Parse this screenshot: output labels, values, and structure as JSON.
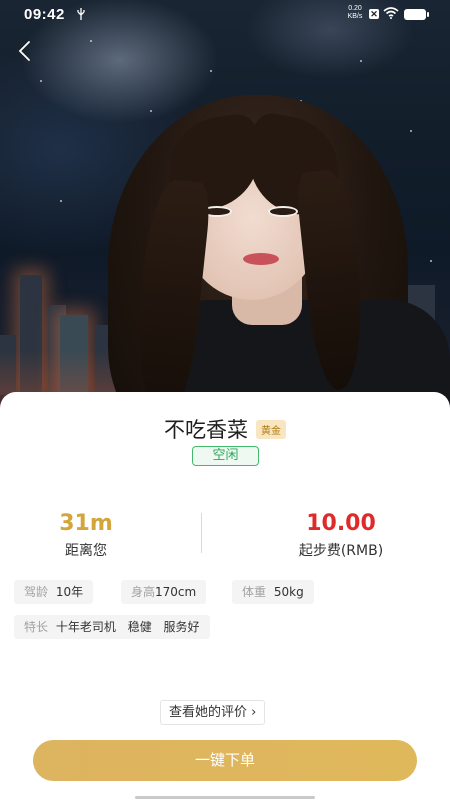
{
  "status_bar": {
    "time": "09:42",
    "net_speed_value": "0.20",
    "net_speed_unit": "KB/s",
    "icons": [
      "usb-icon",
      "x-notification-icon",
      "wifi-icon",
      "battery-icon"
    ]
  },
  "nav": {
    "back_icon": "chevron-left-icon"
  },
  "hero": {
    "description_icon": "driver-photo"
  },
  "driver": {
    "name": "不吃香菜",
    "level": "黄金",
    "status": "空闲"
  },
  "stats": {
    "distance_value": "31m",
    "distance_label": "距离您",
    "fee_value": "10.00",
    "fee_label": "起步费(RMB)"
  },
  "attributes": [
    {
      "key": "驾龄",
      "value": "10年"
    },
    {
      "key": "身高",
      "value": "170cm"
    },
    {
      "key": "体重",
      "value": "50kg"
    }
  ],
  "specialty": {
    "key": "特长",
    "values": [
      "十年老司机",
      "稳健",
      "服务好"
    ]
  },
  "actions": {
    "reviews_label": "查看她的评价",
    "order_label": "一键下单"
  },
  "colors": {
    "accent_gold": "#dfb65e",
    "fee_red": "#e02a2a",
    "status_green": "#2fa65a"
  }
}
